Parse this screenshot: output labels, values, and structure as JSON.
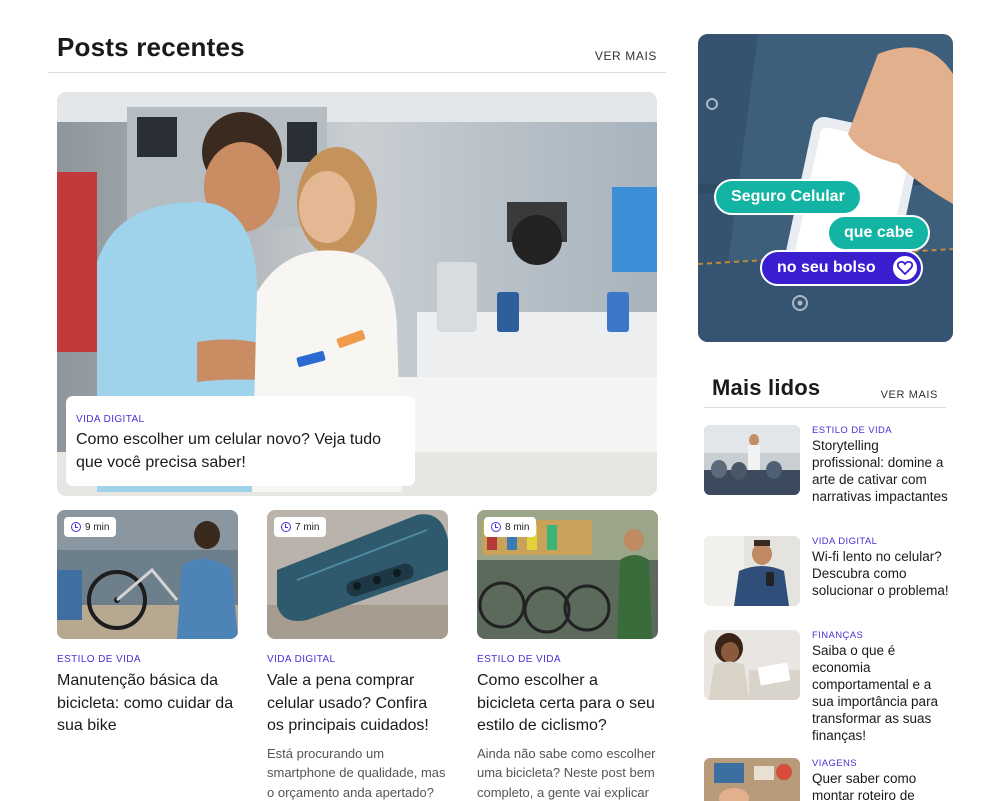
{
  "recent": {
    "title": "Posts recentes",
    "more_label": "VER MAIS",
    "hero": {
      "category": "VIDA DIGITAL",
      "title": "Como escolher um celular novo? Veja tudo que você precisa saber!"
    },
    "cards": [
      {
        "read_time": "9 min",
        "category": "ESTILO DE VIDA",
        "title": "Manutenção básica da bicicleta: como cuidar da sua bike",
        "excerpt": ""
      },
      {
        "read_time": "7 min",
        "category": "VIDA DIGITAL",
        "title": "Vale a pena comprar celular usado? Confira os principais cuidados!",
        "excerpt": "Está procurando um smartphone de qualidade, mas o orçamento anda apertado? Entenda por que"
      },
      {
        "read_time": "8 min",
        "category": "ESTILO DE VIDA",
        "title": "Como escolher a bicicleta certa para o seu estilo de ciclismo?",
        "excerpt": "Ainda não sabe como escolher uma bicicleta? Neste post bem completo, a gente vai explicar todos os pontos que"
      }
    ]
  },
  "ad": {
    "line1": "Seguro Celular",
    "line2": "que cabe",
    "line3": "no seu bolso"
  },
  "popular": {
    "title": "Mais lidos",
    "more_label": "VER MAIS",
    "items": [
      {
        "category": "ESTILO DE VIDA",
        "title": "Storytelling profissional: domine a arte de cativar com narrativas impactantes"
      },
      {
        "category": "VIDA DIGITAL",
        "title": "Wi-fi lento no celular? Descubra como solucionar o problema!"
      },
      {
        "category": "FINANÇAS",
        "title": "Saiba o que é economia comportamental e a sua importância para transformar as suas finanças!"
      },
      {
        "category": "VIAGENS",
        "title": "Quer saber como montar roteiro de"
      }
    ]
  },
  "colors": {
    "category": "#4a2fd6",
    "ad_teal": "#14b4a4",
    "ad_purple": "#3a1fd1",
    "denim": "#3e5f7c"
  },
  "icons": [
    "clock-icon",
    "heart-icon"
  ]
}
